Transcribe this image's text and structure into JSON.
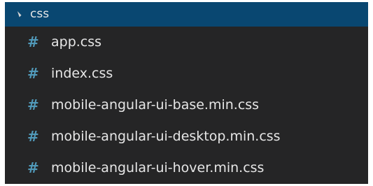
{
  "explorer": {
    "folder": {
      "name": "css",
      "icon": "chevron-expanded-icon",
      "expanded": true
    },
    "file_icon": {
      "glyph": "#",
      "name": "css-hash-icon",
      "color": "#519aba"
    },
    "files": [
      {
        "name": "app.css"
      },
      {
        "name": "index.css"
      },
      {
        "name": "mobile-angular-ui-base.min.css"
      },
      {
        "name": "mobile-angular-ui-desktop.min.css"
      },
      {
        "name": "mobile-angular-ui-hover.min.css"
      }
    ]
  },
  "colors": {
    "panel_background": "#252526",
    "selection": "#094771",
    "text": "#e6e6e6"
  }
}
